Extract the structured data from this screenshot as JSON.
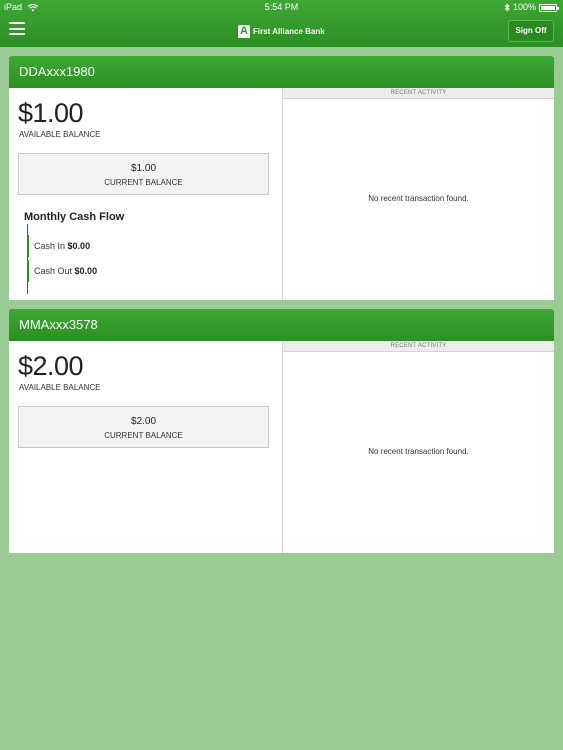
{
  "status_bar": {
    "device": "iPad",
    "time": "5:54 PM",
    "battery": "100%"
  },
  "nav": {
    "logo_mark": "A",
    "logo_text": "First Alliance Bank",
    "sign_off": "Sign Off"
  },
  "accounts": [
    {
      "name": "DDAxxx1980",
      "available_balance": "$1.00",
      "available_label": "AVAILABLE BALANCE",
      "current_balance": "$1.00",
      "current_label": "CURRENT BALANCE",
      "cash_flow_title": "Monthly Cash Flow",
      "cash_in_label": "Cash In",
      "cash_in_value": "$0.00",
      "cash_out_label": "Cash Out",
      "cash_out_value": "$0.00",
      "activity_header": "RECENT ACTIVITY",
      "activity_empty": "No recent transaction found."
    },
    {
      "name": "MMAxxx3578",
      "available_balance": "$2.00",
      "available_label": "AVAILABLE BALANCE",
      "current_balance": "$2.00",
      "current_label": "CURRENT BALANCE",
      "activity_header": "RECENT ACTIVITY",
      "activity_empty": "No recent transaction found."
    }
  ],
  "colors": {
    "brand_green": "#2e9227",
    "background": "#9acb95"
  }
}
